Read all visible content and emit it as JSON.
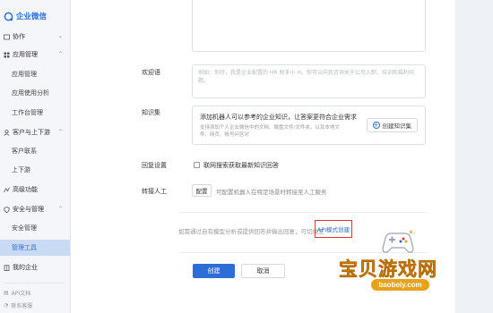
{
  "app": {
    "logo_text": "企业微信"
  },
  "sidebar": {
    "groups": [
      {
        "label": "协作"
      },
      {
        "label": "应用管理"
      },
      {
        "label": "客户与上下游"
      },
      {
        "label": "高级功能"
      },
      {
        "label": "安全与管理"
      },
      {
        "label": "我的企业"
      }
    ],
    "items": [
      {
        "label": "应用管理"
      },
      {
        "label": "应用使用分析"
      },
      {
        "label": "工作台管理"
      },
      {
        "label": "客户联系"
      },
      {
        "label": "上下游"
      },
      {
        "label": "安全管理"
      },
      {
        "label": "管理工具"
      }
    ],
    "bottom": [
      {
        "label": "API文档"
      },
      {
        "label": "联系客服"
      }
    ]
  },
  "form": {
    "greeting_label": "欢迎语",
    "greeting_placeholder": "例如：你好，我是企业配置的 HR 助手小 H。你可以向我咨询关于公司入职、培训和福利问题。",
    "knowledge_label": "知识集",
    "knowledge_title": "添加机器人可以参考的企业知识，让答案更符合企业需求",
    "knowledge_desc": "支持添加个人企业微信中的文档、微盘文件/文件夹，以及本地文件、网页、帐号问答对",
    "knowledge_button": "创建知识集",
    "reply_label": "回复设置",
    "reply_checkbox": "联网搜索获取最新知识回答",
    "handoff_label": "转接人工",
    "handoff_button": "配置",
    "handoff_desc": "可配置机器人在特定场景时转接至人工服务",
    "api_note": "如需通过自有模型分析或提供回答并输出回复，可切换至",
    "api_link": "API模式创建",
    "create_button": "创建",
    "cancel_button": "取消"
  },
  "watermark": {
    "title": "宝贝游戏网",
    "url": "baobeiy.com"
  },
  "colors": {
    "accent": "#2d6dd6",
    "highlight": "#e03131",
    "watermark": "#e8a21a"
  }
}
